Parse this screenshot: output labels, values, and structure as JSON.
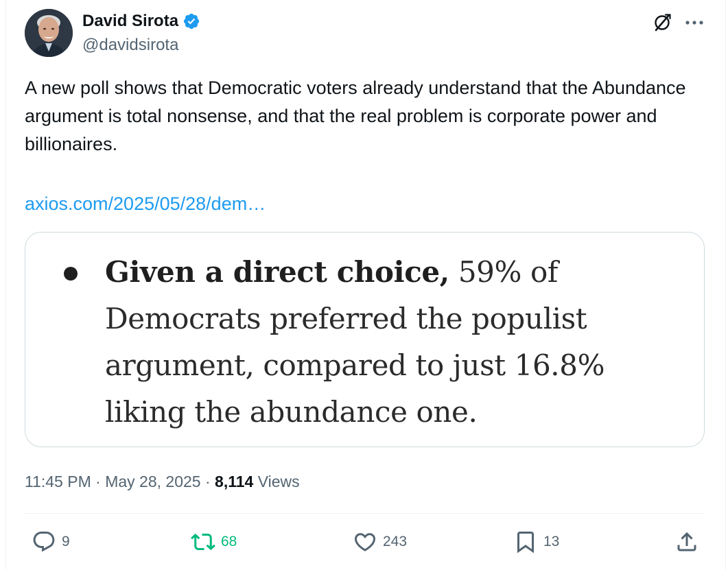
{
  "author": {
    "display_name": "David Sirota",
    "handle": "@davidsirota",
    "verified": true,
    "verified_color": "#1d9bf0"
  },
  "header_icons": [
    "grok-icon",
    "more-icon"
  ],
  "tweet": {
    "text": "A new poll shows that Democratic voters already understand that the Abundance argument is total nonsense, and that the real problem is corporate power and billionaires.",
    "link": "axios.com/2025/05/28/dem…",
    "link_color": "#1d9bf0"
  },
  "media": {
    "bold_lead": "Given a direct choice,",
    "body": " 59% of Democrats preferred the populist argument, compared to just 16.8% liking the abundance one."
  },
  "meta": {
    "time": "11:45 PM",
    "separator": " · ",
    "date": "May 28, 2025",
    "views_count": "8,114",
    "views_label": " Views"
  },
  "actions": {
    "reply_count": "9",
    "retweet_count": "68",
    "retweet_color": "#00ba7c",
    "like_count": "243",
    "bookmark_count": "13"
  }
}
